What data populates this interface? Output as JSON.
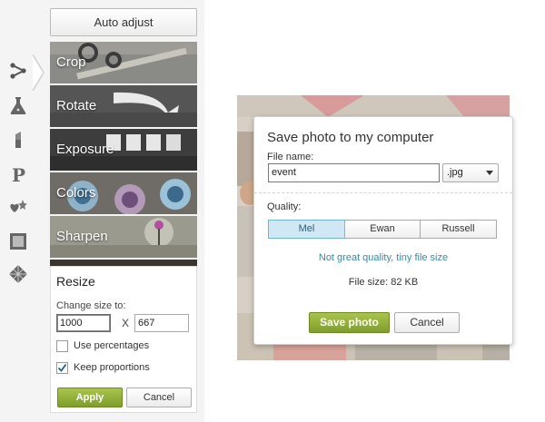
{
  "rail": {
    "icons": [
      "edit-tools-icon",
      "effects-flask-icon",
      "touch-up-lipstick-icon",
      "text-p-icon",
      "overlays-stickers-icon",
      "frames-icon",
      "textures-icon"
    ]
  },
  "panel": {
    "auto_adjust_label": "Auto adjust",
    "tools": [
      {
        "label": "Crop"
      },
      {
        "label": "Rotate"
      },
      {
        "label": "Exposure"
      },
      {
        "label": "Colors"
      },
      {
        "label": "Sharpen"
      }
    ],
    "resize": {
      "title": "Resize",
      "change_size_label": "Change size to:",
      "width_value": "1000",
      "height_value": "667",
      "x_label": "X",
      "use_percentages_label": "Use percentages",
      "use_percentages_checked": false,
      "keep_proportions_label": "Keep proportions",
      "keep_proportions_checked": true,
      "apply_label": "Apply",
      "cancel_label": "Cancel"
    }
  },
  "dialog": {
    "title": "Save photo to my computer",
    "file_name_label": "File name:",
    "file_name_value": "event",
    "extension": ".jpg",
    "quality_label": "Quality:",
    "quality_options": [
      "Mel",
      "Ewan",
      "Russell"
    ],
    "quality_selected": "Mel",
    "quality_hint": "Not great quality, tiny file size",
    "file_size": "File size: 82 KB",
    "save_label": "Save photo",
    "cancel_label": "Cancel"
  },
  "colors": {
    "accent_green": "#8aa83a",
    "link_blue": "#3b8aa4",
    "selected_segment": "#cfe8f3"
  }
}
